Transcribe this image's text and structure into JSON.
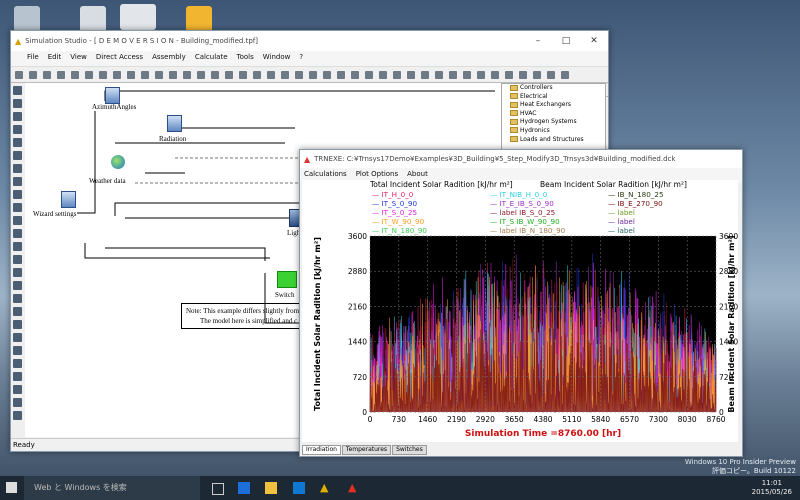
{
  "desktop": {
    "watermark_line1": "Windows 10 Pro Insider Preview",
    "watermark_line2": "評価コピー。Build 10122"
  },
  "studio": {
    "title": "Simulation Studio - [ D E M O V E R S I O N - Building_modified.tpf]",
    "menu": [
      "File",
      "Edit",
      "View",
      "Direct Access",
      "Assembly",
      "Calculate",
      "Tools",
      "Window",
      "?"
    ],
    "components": {
      "azimuth": "AzimuthAngles",
      "radiation": "Radiation",
      "weather": "Weather data",
      "wizard": "Wizard settings",
      "lights": "Lights",
      "switch": "Switch"
    },
    "note_line1": "Note: This example differs slightly from t",
    "note_line2": "The model here is simplified and c",
    "status": "Ready",
    "tree": [
      "Controllers",
      "Electrical",
      "Heat Exchangers",
      "HVAC",
      "Hydrogen Systems",
      "Hydronics",
      "Loads and Structures"
    ]
  },
  "trnexe": {
    "title": "TRNEXE: C:¥Trnsys17Demo¥Examples¥3D_Building¥5_Step_Modify3D_Trnsys3d¥Building_modified.dck",
    "menu": [
      "Calculations",
      "Plot Options",
      "About"
    ],
    "tabs": [
      "Irradiation",
      "Temperatures",
      "Switches"
    ]
  },
  "chart_data": {
    "type": "line",
    "title_left": "Total  Incident Solar Radition [kJ/hr m²]",
    "title_right": "Beam  Incident Solar Radition [kJ/hr m²]",
    "ylabel_left": "Total  Incident Solar Radition [kJ/hr m²]",
    "ylabel_right": "Beam  Incident Solar Radition [kJ/hr m²]",
    "xlabel": "Simulation Time =8760.00 [hr]",
    "xlim": [
      0,
      8760
    ],
    "ylim": [
      0,
      3600
    ],
    "x_ticks": [
      "0",
      "730",
      "1460",
      "2190",
      "2920",
      "3650",
      "4380",
      "5110",
      "5840",
      "6570",
      "7300",
      "8030",
      "8760"
    ],
    "y_ticks": [
      "0",
      "720",
      "1440",
      "2160",
      "2880",
      "3600"
    ],
    "legend": [
      {
        "name": "IT_H_0_0",
        "color": "#e0245e"
      },
      {
        "name": "IT_S_0_90",
        "color": "#1e38d8"
      },
      {
        "name": "IT_S_0_25",
        "color": "#e020e0"
      },
      {
        "name": "IT_W_90_90",
        "color": "#ff9f1c"
      },
      {
        "name": "IT_N_180_90",
        "color": "#3ccf4e"
      },
      {
        "name": "IT_NIB_H_0_0",
        "color": "#2ed0e6"
      },
      {
        "name": "IT_E_IB_S_0_90",
        "color": "#9b2fc0"
      },
      {
        "name": "label IB_S_0_25",
        "color": "#8a1a2a"
      },
      {
        "name": "IT_S IB_W_90_90",
        "color": "#20b020"
      },
      {
        "name": "label IB_N_180_90",
        "color": "#a67c52"
      },
      {
        "name": "IB_N_180_25",
        "color": "#2a3a10"
      },
      {
        "name": "IB_E_270_90",
        "color": "#7a1010"
      },
      {
        "name": "label",
        "color": "#6a9a2a"
      },
      {
        "name": "label",
        "color": "#6a2a9a"
      },
      {
        "name": "label",
        "color": "#2a6a6a"
      }
    ]
  },
  "taskbar": {
    "search": "Web と Windows を検索",
    "time": "11:01",
    "date": "2015/05/26"
  }
}
